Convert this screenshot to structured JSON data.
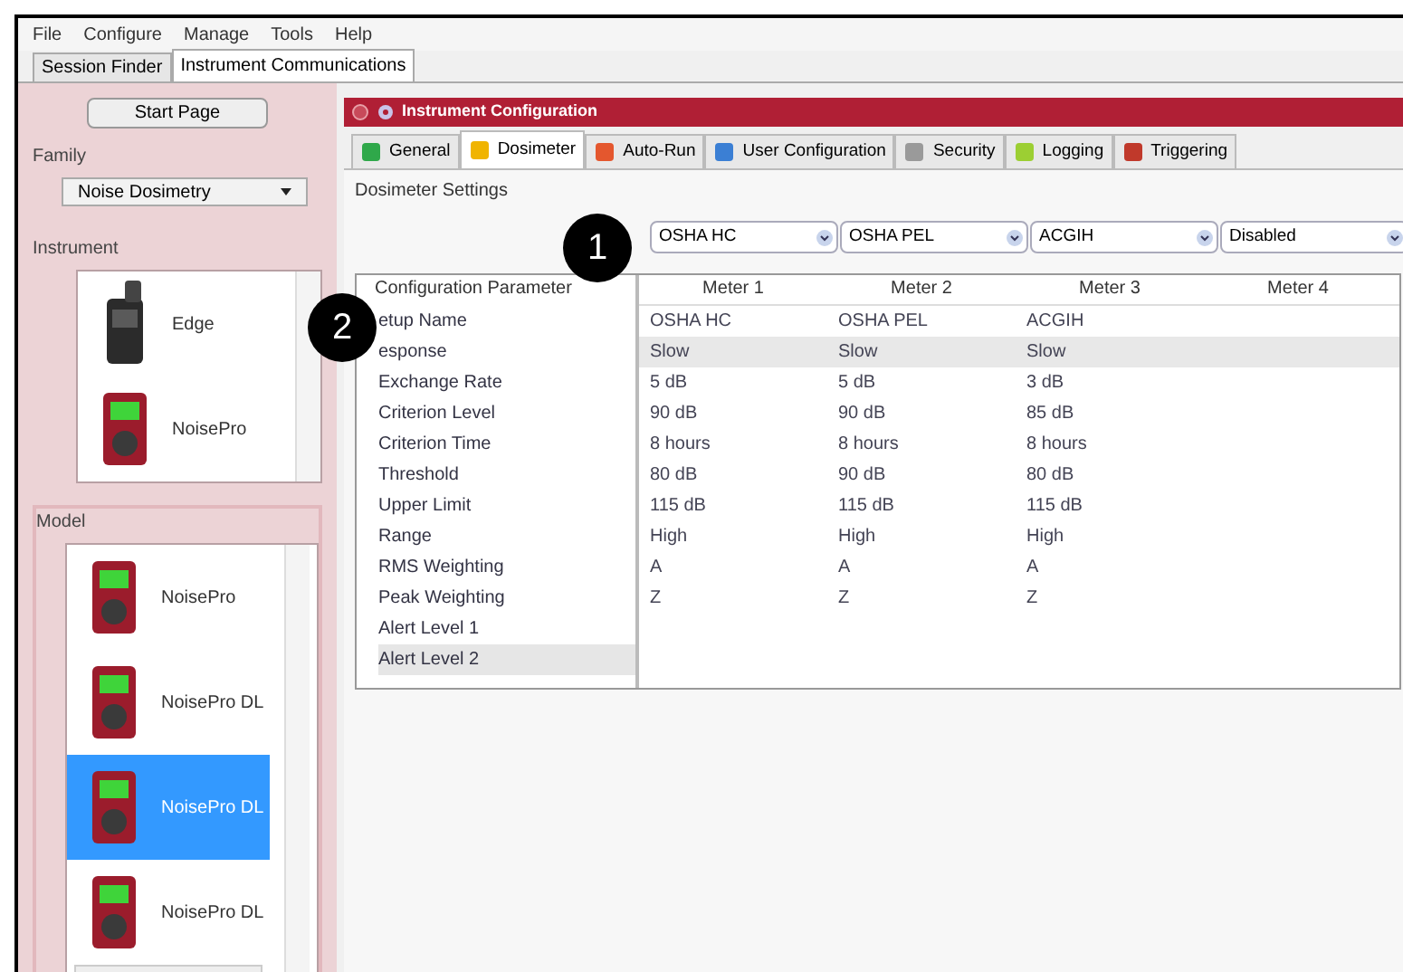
{
  "menu": [
    "File",
    "Configure",
    "Manage",
    "Tools",
    "Help"
  ],
  "main_tabs": [
    {
      "label": "Session Finder",
      "selected": false
    },
    {
      "label": "Instrument Communications",
      "selected": true
    }
  ],
  "sidebar": {
    "start_button": "Start Page",
    "family_label": "Family",
    "family_value": "Noise Dosimetry",
    "instrument_label": "Instrument",
    "instruments": [
      {
        "name": "Edge",
        "kind": "dark",
        "selected": false
      },
      {
        "name": "NoisePro",
        "kind": "red",
        "selected": false
      }
    ],
    "model_label": "Model",
    "models": [
      {
        "name": "NoisePro",
        "kind": "red",
        "selected": false
      },
      {
        "name": "NoisePro DL",
        "kind": "red",
        "selected": false
      },
      {
        "name": "NoisePro DL",
        "kind": "red",
        "selected": true
      },
      {
        "name": "NoisePro DL",
        "kind": "red",
        "selected": false
      }
    ]
  },
  "panel": {
    "title": "Instrument Configuration",
    "tabs": [
      {
        "label": "General",
        "kind": "general",
        "selected": false
      },
      {
        "label": "Dosimeter",
        "kind": "dosimeter",
        "selected": true
      },
      {
        "label": "Auto-Run",
        "kind": "calendar",
        "selected": false
      },
      {
        "label": "User Configuration",
        "kind": "user",
        "selected": false
      },
      {
        "label": "Security",
        "kind": "lock",
        "selected": false
      },
      {
        "label": "Logging",
        "kind": "pencil",
        "selected": false
      },
      {
        "label": "Triggering",
        "kind": "trigger",
        "selected": false
      }
    ],
    "section_title": "Dosimeter Settings",
    "meter_selects": [
      "OSHA HC",
      "OSHA PEL",
      "ACGIH",
      "Disabled"
    ],
    "param_header": "Configuration Parameter",
    "meter_headers": [
      "Meter 1",
      "Meter 2",
      "Meter 3",
      "Meter 4"
    ],
    "rows": [
      {
        "param": "etup Name",
        "values": [
          "OSHA HC",
          "OSHA PEL",
          "ACGIH"
        ],
        "selected": false,
        "param_selected": false
      },
      {
        "param": "esponse",
        "values": [
          "Slow",
          "Slow",
          "Slow"
        ],
        "selected": true,
        "param_selected": false
      },
      {
        "param": "Exchange Rate",
        "values": [
          "5 dB",
          "5 dB",
          "3 dB"
        ],
        "selected": false,
        "param_selected": false
      },
      {
        "param": "Criterion Level",
        "values": [
          "90 dB",
          "90 dB",
          "85 dB"
        ],
        "selected": false,
        "param_selected": false
      },
      {
        "param": "Criterion Time",
        "values": [
          "8 hours",
          "8 hours",
          "8 hours"
        ],
        "selected": false,
        "param_selected": false
      },
      {
        "param": "Threshold",
        "values": [
          "80 dB",
          "90 dB",
          "80 dB"
        ],
        "selected": false,
        "param_selected": false
      },
      {
        "param": "Upper Limit",
        "values": [
          "115 dB",
          "115 dB",
          "115 dB"
        ],
        "selected": false,
        "param_selected": false
      },
      {
        "param": "Range",
        "values": [
          "High",
          "High",
          "High"
        ],
        "selected": false,
        "param_selected": false
      },
      {
        "param": "RMS Weighting",
        "values": [
          "A",
          "A",
          "A"
        ],
        "selected": false,
        "param_selected": false
      },
      {
        "param": "Peak Weighting",
        "values": [
          "Z",
          "Z",
          "Z"
        ],
        "selected": false,
        "param_selected": false
      },
      {
        "param": "Alert Level 1",
        "values": [],
        "selected": false,
        "param_selected": false
      },
      {
        "param": "Alert Level 2",
        "values": [],
        "selected": false,
        "param_selected": true
      }
    ]
  },
  "callouts": [
    "1",
    "2"
  ]
}
